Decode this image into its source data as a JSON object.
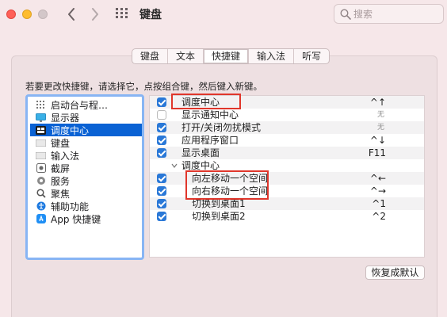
{
  "window": {
    "title": "键盘",
    "search_placeholder": "搜索"
  },
  "tabs": [
    {
      "label": "键盘",
      "active": false
    },
    {
      "label": "文本",
      "active": false
    },
    {
      "label": "快捷键",
      "active": true
    },
    {
      "label": "输入法",
      "active": false
    },
    {
      "label": "听写",
      "active": false
    }
  ],
  "instruction": "若要更改快捷键，请选择它，点按组合键，然后键入新键。",
  "categories": [
    {
      "label": "启动台与程…",
      "icon": "launchpad-icon",
      "selected": false
    },
    {
      "label": "显示器",
      "icon": "display-icon",
      "selected": false
    },
    {
      "label": "调度中心",
      "icon": "mission-control-icon",
      "selected": true
    },
    {
      "label": "键盘",
      "icon": "keyboard-icon",
      "selected": false
    },
    {
      "label": "输入法",
      "icon": "input-method-icon",
      "selected": false
    },
    {
      "label": "截屏",
      "icon": "screenshot-icon",
      "selected": false
    },
    {
      "label": "服务",
      "icon": "services-gear-icon",
      "selected": false
    },
    {
      "label": "聚焦",
      "icon": "spotlight-icon",
      "selected": false
    },
    {
      "label": "辅助功能",
      "icon": "accessibility-icon",
      "selected": false
    },
    {
      "label": "App 快捷键",
      "icon": "app-store-icon",
      "selected": false
    }
  ],
  "shortcuts": [
    {
      "label": "调度中心",
      "key": "^↑",
      "checked": true,
      "level": 0
    },
    {
      "label": "显示通知中心",
      "key": "无",
      "checked": false,
      "level": 0
    },
    {
      "label": "打开/关闭勿扰模式",
      "key": "无",
      "checked": true,
      "level": 0
    },
    {
      "label": "应用程序窗口",
      "key": "^↓",
      "checked": true,
      "level": 0
    },
    {
      "label": "显示桌面",
      "key": "F11",
      "checked": true,
      "level": 0
    },
    {
      "label": "调度中心",
      "key": "",
      "checked": null,
      "level": 0,
      "group": true
    },
    {
      "label": "向左移动一个空间",
      "key": "^←",
      "checked": true,
      "level": 1
    },
    {
      "label": "向右移动一个空间",
      "key": "^→",
      "checked": true,
      "level": 1
    },
    {
      "label": "切换到桌面1",
      "key": "^1",
      "checked": true,
      "level": 1
    },
    {
      "label": "切换到桌面2",
      "key": "^2",
      "checked": true,
      "level": 1
    }
  ],
  "restore_button": "恢复成默认",
  "colors": {
    "accent": "#0a62d4",
    "checkbox": "#2a78d7",
    "highlight_box": "#e0362b",
    "background": "#f6e7e9"
  }
}
